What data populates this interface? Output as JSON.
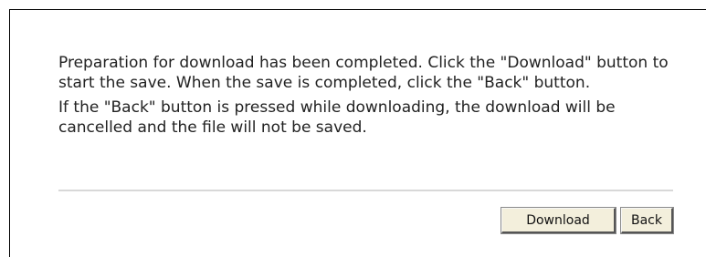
{
  "dialog": {
    "message_1": "Preparation for download has been completed. Click the \"Download\" button to start the save. When the save is completed, click the \"Back\" button.",
    "message_2": "If the \"Back\" button is pressed while downloading, the download will be cancelled and the file will not be saved."
  },
  "buttons": {
    "download_label": "Download",
    "back_label": "Back"
  }
}
